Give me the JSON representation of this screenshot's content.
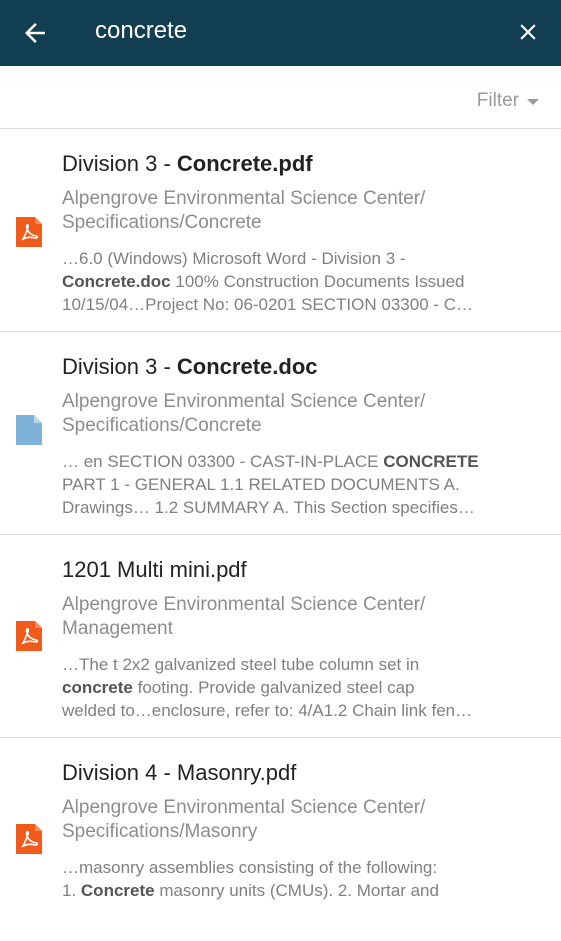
{
  "appbar": {
    "search_query": "concrete",
    "back_icon": "arrow-left-icon",
    "close_icon": "close-icon"
  },
  "filter": {
    "label": "Filter"
  },
  "colors": {
    "appbar_bg": "#123e52",
    "pdf_icon": "#f05a1a",
    "doc_icon": "#7fb2d8"
  },
  "results": [
    {
      "icon": "pdf-file-icon",
      "title_prefix": "Division 3 - ",
      "title_match": "Concrete.pdf",
      "title_suffix": "",
      "path_line1": "Alpengrove Environmental Science Center/",
      "path_line2": "Specifications/Concrete",
      "snippet_l1": "…6.0 (Windows) Microsoft Word - Division 3 -",
      "snippet_l2_match": "Concrete.doc",
      "snippet_l2_rest": " 100% Construction Documents Issued",
      "snippet_l3": "10/15/04…Project No: 06-0201 SECTION 03300 - C…"
    },
    {
      "icon": "doc-file-icon",
      "title_prefix": "Division 3 - ",
      "title_match": "Concrete.doc",
      "title_suffix": "",
      "path_line1": "Alpengrove Environmental Science Center/",
      "path_line2": "Specifications/Concrete",
      "snippet_l1_pre": "… en SECTION 03300 - CAST-IN-PLACE ",
      "snippet_l1_match": "CONCRETE",
      "snippet_l2": "PART 1 - GENERAL 1.1 RELATED DOCUMENTS A.",
      "snippet_l3": "Drawings… 1.2 SUMMARY A. This Section specifies…"
    },
    {
      "icon": "pdf-file-icon",
      "title": "1201 Multi mini.pdf",
      "path_line1": "Alpengrove Environmental Science Center/",
      "path_line2": "Management",
      "snippet_l1": "…The t 2x2 galvanized steel tube column set in",
      "snippet_l2_match": "concrete",
      "snippet_l2_rest": " footing. Provide galvanized steel cap",
      "snippet_l3": "welded to…enclosure, refer to: 4/A1.2 Chain link fen…"
    },
    {
      "icon": "pdf-file-icon",
      "title": "Division 4 - Masonry.pdf",
      "path_line1": "Alpengrove Environmental Science Center/",
      "path_line2": "Specifications/Masonry",
      "snippet_l1": "…masonry assemblies consisting of the following:",
      "snippet_l2_pre": "1. ",
      "snippet_l2_match": "Concrete",
      "snippet_l2_rest": " masonry units (CMUs). 2. Mortar and"
    }
  ]
}
